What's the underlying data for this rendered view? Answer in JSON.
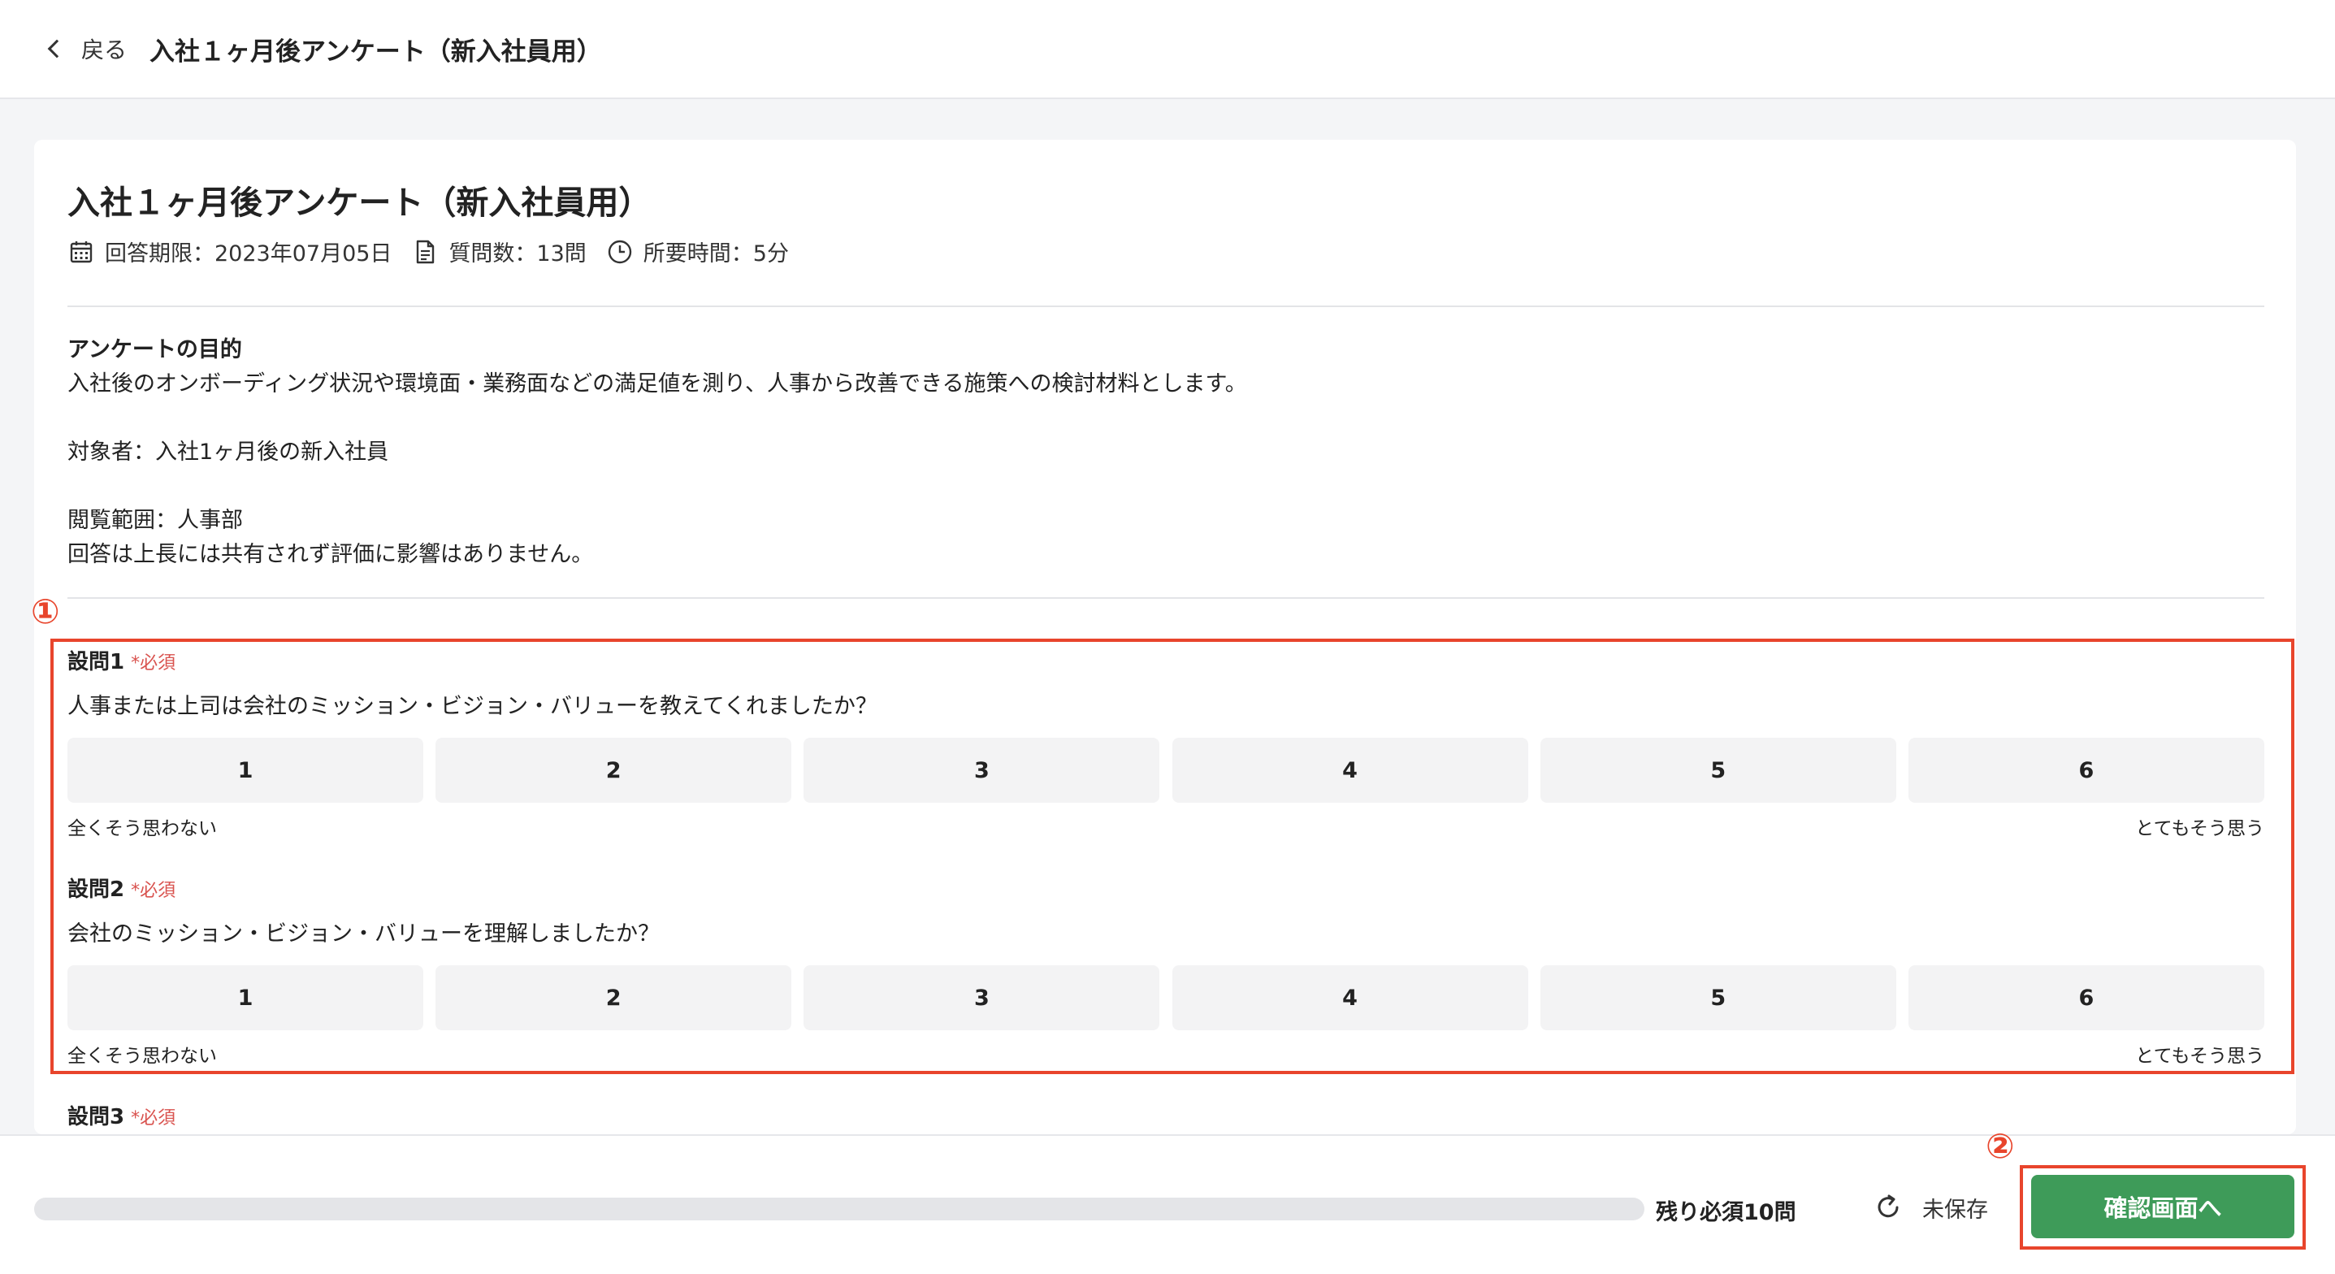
{
  "header": {
    "back_label": "戻る",
    "title": "入社１ヶ月後アンケート（新入社員用）"
  },
  "survey": {
    "title": "入社１ヶ月後アンケート（新入社員用）",
    "deadline": "回答期限：2023年07月05日",
    "question_count": "質問数：13問",
    "duration": "所要時間：5分",
    "purpose_title": "アンケートの目的",
    "purpose_text": "入社後のオンボーディング状況や環境面・業務面などの満足値を測り、人事から改善できる施策への検討材料とします。",
    "target": "対象者：入社1ヶ月後の新入社員",
    "viewing_scope": "閲覧範囲：人事部",
    "note": "回答は上長には共有されず評価に影響はありません。"
  },
  "questions": [
    {
      "number": "設問1",
      "required": "*必須",
      "text": "人事または上司は会社のミッション・ビジョン・バリューを教えてくれましたか？",
      "options": [
        "1",
        "2",
        "3",
        "4",
        "5",
        "6"
      ],
      "min_label": "全くそう思わない",
      "max_label": "とてもそう思う"
    },
    {
      "number": "設問2",
      "required": "*必須",
      "text": "会社のミッション・ビジョン・バリューを理解しましたか？",
      "options": [
        "1",
        "2",
        "3",
        "4",
        "5",
        "6"
      ],
      "min_label": "全くそう思わない",
      "max_label": "とてもそう思う"
    },
    {
      "number": "設問3",
      "required": "*必須"
    }
  ],
  "annotations": {
    "marker1": "①",
    "marker2": "②",
    "color": "#e8452c"
  },
  "footer": {
    "progress": 0,
    "remaining": "残り必須10問",
    "save_status": "未保存",
    "confirm_label": "確認画面へ",
    "confirm_color": "#3e9b59"
  }
}
